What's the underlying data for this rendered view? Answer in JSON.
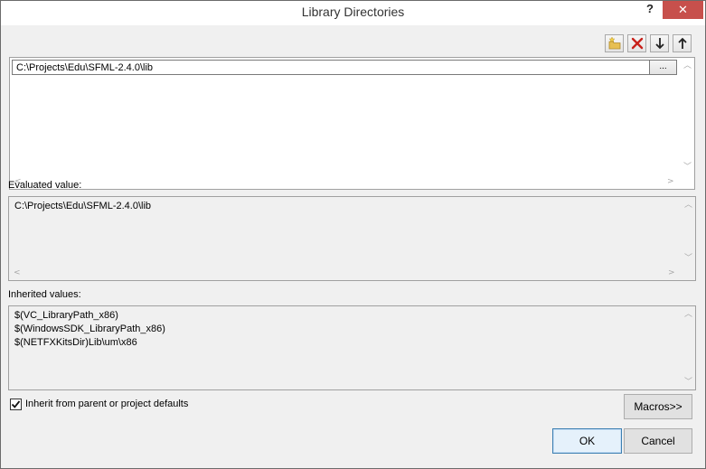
{
  "window": {
    "title": "Library Directories",
    "help_label": "?",
    "close_label": "✕"
  },
  "toolbar": {
    "icons": [
      "new-line-icon",
      "delete-icon",
      "move-down-icon",
      "move-up-icon"
    ]
  },
  "directory_list": {
    "entries": [
      "C:\\Projects\\Edu\\SFML-2.4.0\\lib"
    ],
    "browse_label": "..."
  },
  "evaluated": {
    "label": "Evaluated value:",
    "lines": [
      "C:\\Projects\\Edu\\SFML-2.4.0\\lib"
    ]
  },
  "inherited": {
    "label": "Inherited values:",
    "lines": [
      "$(VC_LibraryPath_x86)",
      "$(WindowsSDK_LibraryPath_x86)",
      "$(NETFXKitsDir)Lib\\um\\x86"
    ]
  },
  "inherit_checkbox": {
    "label": "Inherit from parent or project defaults",
    "checked": true
  },
  "buttons": {
    "macros": "Macros>>",
    "ok": "OK",
    "cancel": "Cancel"
  },
  "colors": {
    "close_button": "#c7504c",
    "dialog_bg": "#f0f0f0",
    "default_button_border": "#3c7fb1"
  }
}
